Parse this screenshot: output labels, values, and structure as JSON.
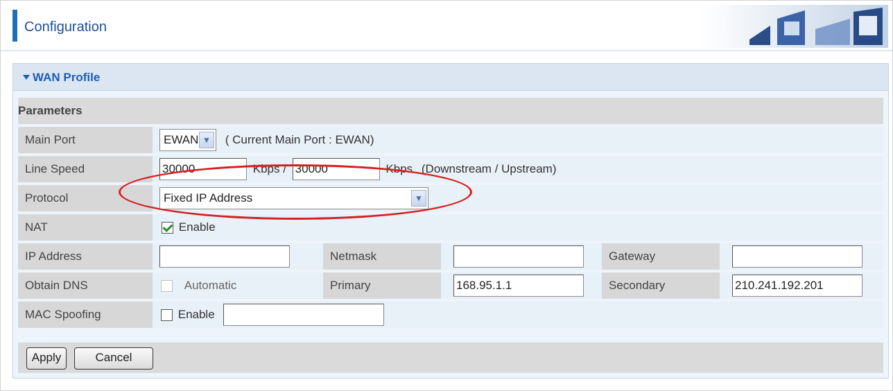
{
  "header": {
    "title": "Configuration",
    "graphic_icon": "header-photo-banner"
  },
  "panel": {
    "title": "WAN Profile",
    "section": "Parameters"
  },
  "fields": {
    "main_port": {
      "label": "Main Port",
      "value": "EWAN",
      "note": "( Current Main Port : EWAN)"
    },
    "line_speed": {
      "label": "Line Speed",
      "down": "30000",
      "unit1": "Kbps /",
      "up": "30000",
      "unit2": "Kbps",
      "note": "(Downstream / Upstream)"
    },
    "protocol": {
      "label": "Protocol",
      "value": "Fixed IP Address"
    },
    "nat": {
      "label": "NAT",
      "checked": true,
      "option": "Enable"
    },
    "ip_address": {
      "label": "IP Address",
      "value": "",
      "netmask_label": "Netmask",
      "netmask": "",
      "gateway_label": "Gateway",
      "gateway": ""
    },
    "obtain_dns": {
      "label": "Obtain DNS",
      "checked": false,
      "option": "Automatic",
      "primary_label": "Primary",
      "primary": "168.95.1.1",
      "secondary_label": "Secondary",
      "secondary": "210.241.192.201"
    },
    "mac_spoofing": {
      "label": "MAC Spoofing",
      "checked": false,
      "option": "Enable",
      "value": ""
    }
  },
  "buttons": {
    "apply": "Apply",
    "cancel": "Cancel"
  },
  "colors": {
    "accent": "#1f6fb8",
    "title": "#1d5db4",
    "highlight_oval": "#d42020"
  }
}
